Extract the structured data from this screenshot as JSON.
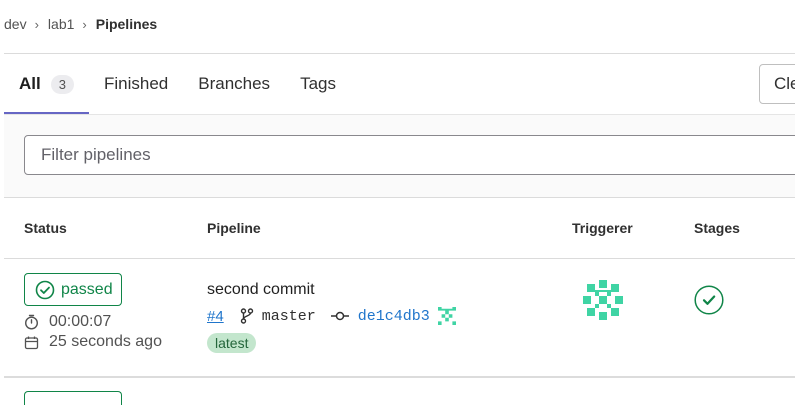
{
  "breadcrumb": {
    "items": [
      "dev",
      "lab1"
    ],
    "current": "Pipelines"
  },
  "tabs": [
    {
      "label": "All",
      "count": "3",
      "active": true
    },
    {
      "label": "Finished"
    },
    {
      "label": "Branches"
    },
    {
      "label": "Tags"
    }
  ],
  "clear_button": {
    "label": "Cle"
  },
  "filter": {
    "placeholder": "Filter pipelines",
    "value": ""
  },
  "table": {
    "headers": {
      "status": "Status",
      "pipeline": "Pipeline",
      "triggerer": "Triggerer",
      "stages": "Stages"
    },
    "rows": [
      {
        "status": "passed",
        "duration": "00:00:07",
        "finished": "25 seconds ago",
        "commit_title": "second commit",
        "pipeline_id": "#4",
        "ref": "master",
        "sha": "de1c4db3",
        "badge": "latest",
        "stage_status": "success"
      }
    ]
  },
  "colors": {
    "success": "#108548",
    "link": "#1f75cb",
    "tab_underline": "#6666c4",
    "avatar": "#3fd4a4",
    "latest_bg": "#c3e6cd"
  },
  "icons": [
    "chevron-right-icon",
    "status-success-icon",
    "timer-icon",
    "calendar-icon",
    "branch-icon",
    "commit-icon",
    "avatar-identicon",
    "stage-success-icon"
  ]
}
